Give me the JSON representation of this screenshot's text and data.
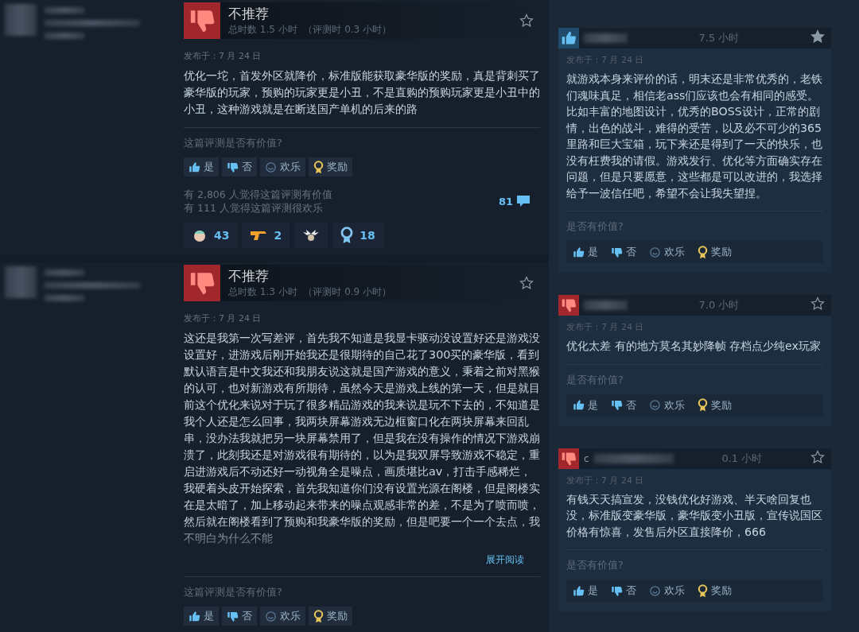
{
  "left_reviews": [
    {
      "recommended": false,
      "verdict": "不推荐",
      "hours": "总时数 1.5 小时",
      "review_hours": "（评测时 0.3 小时）",
      "posted": "发布于：7 月 24 日",
      "body": "优化一坨，首发外区就降价，标准版能获取豪华版的奖励，真是背刺买了豪华版的玩家，预购的玩家更是小丑，不是直购的预购玩家更是小丑中的小丑，这种游戏就是在断送国产单机的后来的路",
      "truncated": false,
      "helpful_prompt": "这篇评测是否有价值?",
      "buttons": [
        {
          "kind": "yes",
          "label": "是"
        },
        {
          "kind": "no",
          "label": "否"
        },
        {
          "kind": "funny",
          "label": "欢乐"
        },
        {
          "kind": "award",
          "label": "奖励"
        }
      ],
      "helpful_count": "有 2,806 人觉得这篇评测有价值",
      "funny_count": "有 111 人觉得这篇评测很欢乐",
      "comments": "81",
      "awards": [
        {
          "kind": "face",
          "count": "43"
        },
        {
          "kind": "pistol",
          "count": "2"
        },
        {
          "kind": "antlers"
        },
        {
          "kind": "medal",
          "count": "18"
        }
      ]
    },
    {
      "recommended": false,
      "verdict": "不推荐",
      "hours": "总时数 1.3 小时",
      "review_hours": "（评测时 0.9 小时）",
      "posted": "发布于：7 月 24 日",
      "body": "这还是我第一次写差评，首先我不知道是我显卡驱动没设置好还是游戏没设置好，进游戏后刚开始我还是很期待的自己花了300买的豪华版，看到默认语言是中文我还和我朋友说这就是国产游戏的意义，秉着之前对黑猴的认可，也对新游戏有所期待，虽然今天是游戏上线的第一天，但是就目前这个优化来说对于玩了很多精品游戏的我来说是玩不下去的，不知道是我个人还是怎么回事，我两块屏幕游戏无边框窗口化在两块屏幕来回乱串，没办法我就把另一块屏幕禁用了，但是我在没有操作的情况下游戏崩溃了，此刻我还是对游戏很有期待的，以为是我双屏导致游戏不稳定，重启进游戏后不动还好一动视角全是噪点，画质堪比av，打击手感稀烂，我硬着头皮开始探索，首先我知道你们没有设置光源在阁楼，但是阁楼实在是太暗了，加上移动起来带来的噪点观感非常的差，不是为了喷而喷，然后就在阁楼看到了预购和我豪华版的奖励，但是吧要一个一个去点，我不明白为什么不能",
      "truncated": true,
      "expand": "展开阅读",
      "helpful_prompt": "这篇评测是否有价值?",
      "buttons": [
        {
          "kind": "yes",
          "label": "是"
        },
        {
          "kind": "no",
          "label": "否"
        },
        {
          "kind": "funny",
          "label": "欢乐"
        },
        {
          "kind": "award",
          "label": "奖励"
        }
      ]
    }
  ],
  "side_reviews": [
    {
      "recommended": true,
      "hours": "7.5 小时",
      "starred": true,
      "posted": "发布于：7 月 24 日",
      "body": "就游戏本身来评价的话，明末还是非常优秀的，老铁们魂味真足，相信老ass们应该也会有相同的感受。比如丰富的地图设计，优秀的BOSS设计，正常的剧情，出色的战斗，难得的受苦，以及必不可少的365里路和巨大宝箱，玩下来还是得到了一天的快乐，也没有枉费我的请假。游戏发行、优化等方面确实存在问题，但是只要愿意，这些都是可以改进的，我选择给予一波信任吧，希望不会让我失望捏。",
      "helpful_prompt": "是否有价值?",
      "buttons": [
        {
          "kind": "yes",
          "label": "是"
        },
        {
          "kind": "no",
          "label": "否"
        },
        {
          "kind": "funny",
          "label": "欢乐"
        },
        {
          "kind": "award",
          "label": "奖励"
        }
      ]
    },
    {
      "recommended": false,
      "hours": "7.0 小时",
      "starred": false,
      "posted": "发布于：7 月 24 日",
      "body": "优化太差 有的地方莫名其妙降帧 存档点少纯ex玩家",
      "helpful_prompt": "是否有价值?",
      "buttons": [
        {
          "kind": "yes",
          "label": "是"
        },
        {
          "kind": "no",
          "label": "否"
        },
        {
          "kind": "funny",
          "label": "欢乐"
        },
        {
          "kind": "award",
          "label": "奖励"
        }
      ]
    },
    {
      "recommended": false,
      "name_prefix": "c",
      "hours": "0.1 小时",
      "starred": false,
      "posted": "发布于：7 月 24 日",
      "body": "有钱天天搞宣发，没钱优化好游戏、半天啥回复也没，标准版变豪华版，豪华版变小丑版，宣传说国区价格有惊喜，发售后外区直接降价，666",
      "helpful_prompt": "是否有价值?",
      "buttons": [
        {
          "kind": "yes",
          "label": "是"
        },
        {
          "kind": "no",
          "label": "否"
        },
        {
          "kind": "funny",
          "label": "欢乐"
        },
        {
          "kind": "award",
          "label": "奖励"
        }
      ]
    }
  ]
}
